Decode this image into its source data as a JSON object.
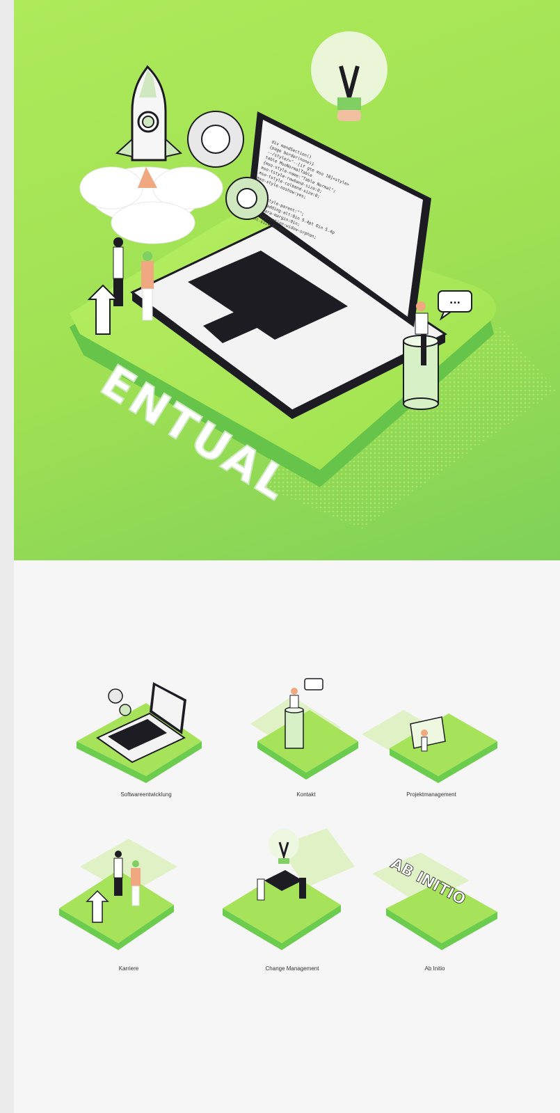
{
  "hero": {
    "wordmark": "ENTUAL",
    "code_lines": [
      "div mandSection()",
      "  {page border(none)}",
      "--/style/>\"--[if gte mso 10]<style>",
      "table MsoNormalTable",
      "{mso-style-name:\"Table Normal\";",
      "mso-tstyle-rowband-size:0;",
      "mso-tstyle-colband-size:0;",
      "mso-style-noshow:yes;",
      "mso-style-parent:\"\";",
      "mso-padding-alt:0in 5.4pt 0in 5.4p",
      "mso-para-margin:0in;",
      "mso-pagination:widow-orphan;",
      "font-size:11.0pt;"
    ],
    "chat_icon_text": "..."
  },
  "tiles": [
    {
      "label": "Softwareentwicklung"
    },
    {
      "label": "Kontakt"
    },
    {
      "label": "Projektmanagement"
    },
    {
      "label": "Karriere"
    },
    {
      "label": "Change Management"
    },
    {
      "label": "Ab Initio",
      "logo_text": "AB INITIO"
    }
  ],
  "colors": {
    "brand_green": "#a6e35a",
    "dark_green": "#6ccc4e",
    "background": "#f6f6f6",
    "ink": "#1c1c22"
  }
}
